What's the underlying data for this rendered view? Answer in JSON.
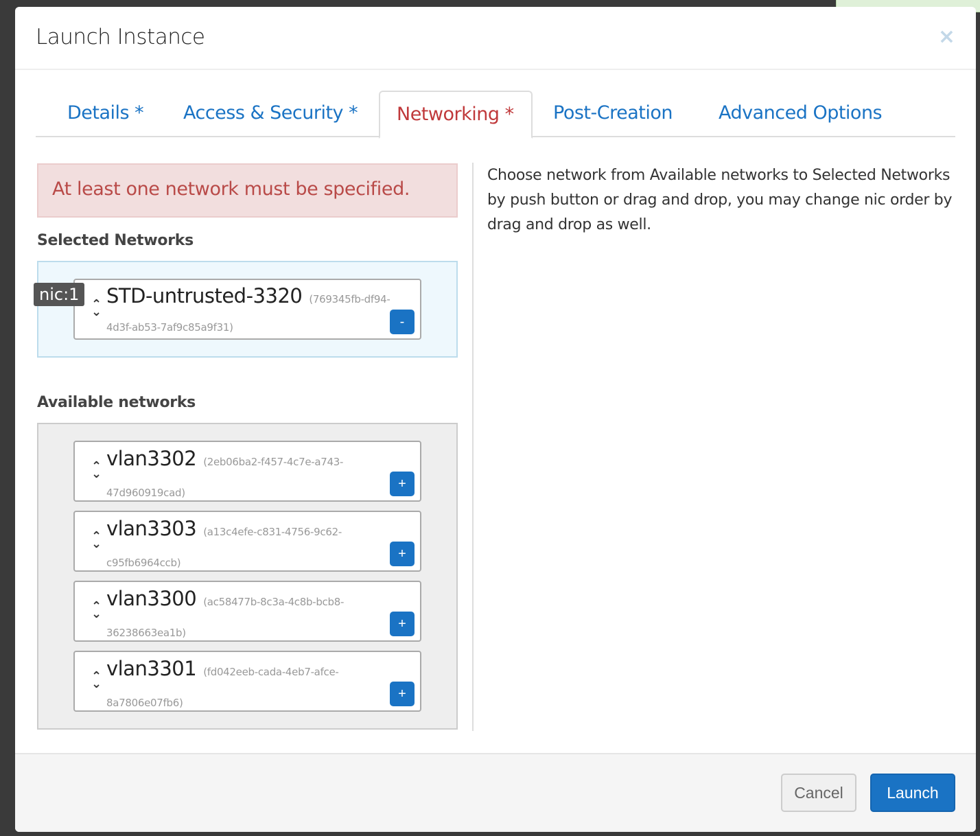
{
  "modal": {
    "title": "Launch Instance",
    "close_icon": "×"
  },
  "tabs": [
    {
      "label": "Details *",
      "active": false
    },
    {
      "label": "Access & Security *",
      "active": false
    },
    {
      "label": "Networking *",
      "active": true
    },
    {
      "label": "Post-Creation",
      "active": false
    },
    {
      "label": "Advanced Options",
      "active": false
    }
  ],
  "error": "At least one network must be specified.",
  "selected": {
    "heading": "Selected Networks",
    "items": [
      {
        "nic": "nic:1",
        "name": "STD-untrusted-3320",
        "id": "(769345fb-df94-4d3f-ab53-7af9c85a9f31)",
        "button": "-"
      }
    ]
  },
  "available": {
    "heading": "Available networks",
    "items": [
      {
        "name": "vlan3302",
        "id": "(2eb06ba2-f457-4c7e-a743-47d960919cad)",
        "button": "+"
      },
      {
        "name": "vlan3303",
        "id": "(a13c4efe-c831-4756-9c62-c95fb6964ccb)",
        "button": "+"
      },
      {
        "name": "vlan3300",
        "id": "(ac58477b-8c3a-4c8b-bcb8-36238663ea1b)",
        "button": "+"
      },
      {
        "name": "vlan3301",
        "id": "(fd042eeb-cada-4eb7-afce-8a7806e07fb6)",
        "button": "+"
      }
    ]
  },
  "help": "Choose network from Available networks to Selected Networks by push button or drag and drop, you may change nic order by drag and drop as well.",
  "footer": {
    "cancel": "Cancel",
    "launch": "Launch"
  },
  "colors": {
    "accent": "#1a73c4",
    "error": "#b94a48",
    "active_tab": "#c0393b"
  }
}
